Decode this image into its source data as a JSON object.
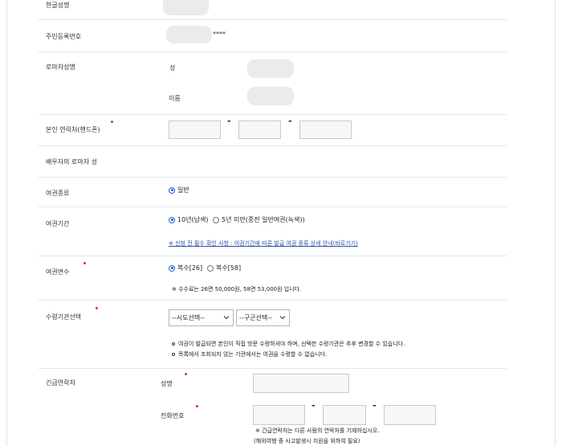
{
  "form": {
    "korean_name": {
      "label": "한글성명"
    },
    "resident_number": {
      "label": "주민등록번호",
      "masked": "****"
    },
    "roman_name": {
      "label": "로마자성명",
      "surname_label": "성",
      "given_name_label": "이름"
    },
    "mobile": {
      "label": "본인 연락처(핸드폰)",
      "separator": "-"
    },
    "spouse_roman_surname": {
      "label": "배우자의 로마자 성"
    },
    "passport_type": {
      "label": "여권종류",
      "option": "일반"
    },
    "passport_validity": {
      "label": "여권기간",
      "options": [
        "10년(남색)",
        "5년 미만(종전 일반여권(녹색))"
      ],
      "selected": 0,
      "notice_link": "※ 신청 전 필수 확인 사항 : 여권기간에 따른 발급 여권 종류 상세 안내(바로가기)"
    },
    "page_count": {
      "label": "여권면수",
      "options": [
        "복수[26]",
        "복수[58]"
      ],
      "selected": 0,
      "fee_note": "※ 수수료는 26면 50,000원, 58면 53,000원 입니다."
    },
    "pickup_office": {
      "label": "수령기관선택",
      "province_select": "--시도선택--",
      "district_select": "--구군선택--",
      "notes": [
        "여권이 발급되면 본인이 직접 방문 수령하셔야 하며, 선택한 수령기관은 추후 변경할 수 있습니다.",
        "목록에서 조회되지 않는 기관에서는 여권을 수령할 수 없습니다."
      ]
    },
    "emergency_contact": {
      "label": "긴급연락처",
      "name_label": "성명",
      "phone_label": "전화번호",
      "separator": "-",
      "notes": [
        "※ 긴급연락처는 다른 사람의 연락처를 기재하십시오.",
        "(해외여행 중 사고발생시 지원을 위하여 필요)"
      ]
    }
  },
  "colors": {
    "required_dot": "#e0302f",
    "radio_selected": "#1a66d9",
    "link": "#2a4fa8"
  }
}
